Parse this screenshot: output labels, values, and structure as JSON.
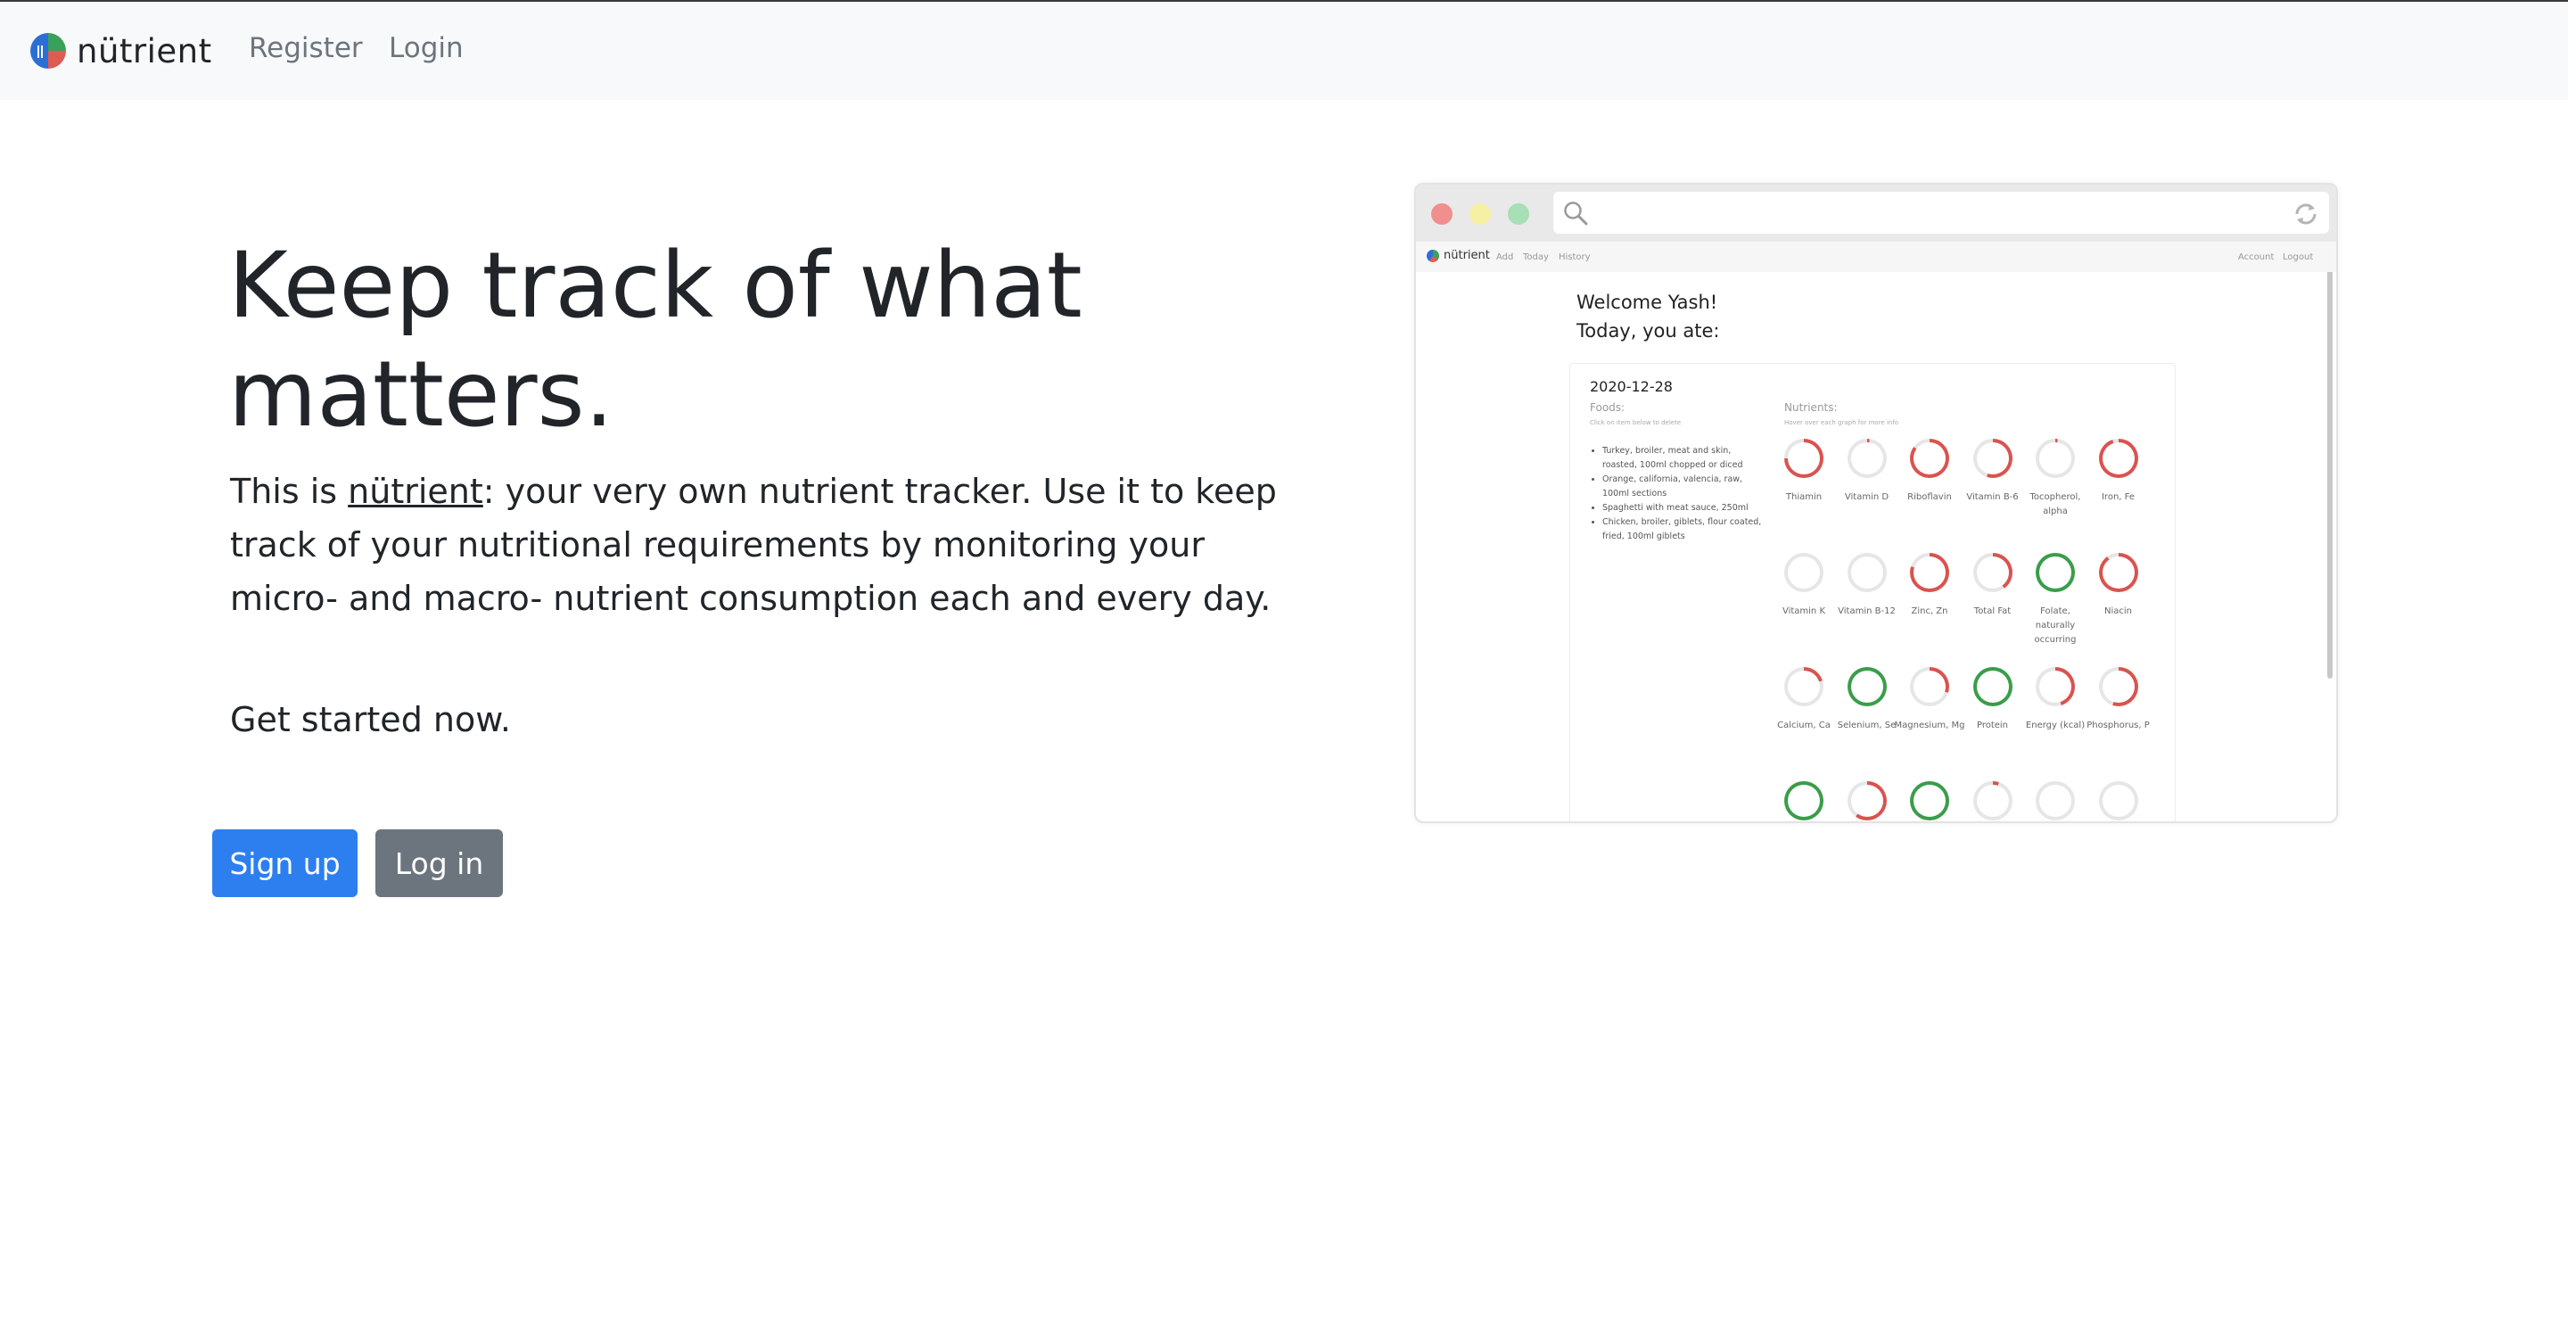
{
  "navbar": {
    "brand": "nütrient",
    "links": {
      "register": "Register",
      "login": "Login"
    }
  },
  "hero": {
    "title": "Keep track of what matters.",
    "text_prefix": "This is ",
    "text_brand": "nütrient",
    "text_suffix": ": your very own nutrient tracker. Use it to keep track of your nutritional requirements by monitoring your micro- and macro- nutrient consumption each and every day.",
    "cta": "Get started now.",
    "signup_label": "Sign up",
    "login_label": "Log in"
  },
  "colors": {
    "primary": "#2d7ff0",
    "secondary": "#6c757d",
    "ring_red": "#d9534f",
    "ring_green": "#3a9d4a",
    "ring_grey": "#e6e6e6"
  },
  "preview": {
    "nav": {
      "brand": "nütrient",
      "links": [
        "Add",
        "Today",
        "History"
      ],
      "right_links": [
        "Account",
        "Logout"
      ]
    },
    "welcome": "Welcome Yash!",
    "subtitle": "Today, you ate:",
    "date": "2020-12-28",
    "foods_label": "Foods:",
    "foods_hint": "Click on item below to delete",
    "foods": [
      "Turkey, broiler, meat and skin, roasted, 100ml chopped or diced",
      "Orange, california, valencia, raw, 100ml sections",
      "Spaghetti with meat sauce, 250ml",
      "Chicken, broiler, giblets, flour coated, fried, 100ml giblets"
    ],
    "nutrients_label": "Nutrients:",
    "nutrients_hint": "Hover over each graph for more info",
    "nutrients": [
      {
        "name": "Thiamin",
        "fraction": 0.75,
        "color": "red"
      },
      {
        "name": "Vitamin D",
        "fraction": 0.02,
        "color": "red"
      },
      {
        "name": "Riboflavin",
        "fraction": 0.85,
        "color": "red"
      },
      {
        "name": "Vitamin B-6",
        "fraction": 0.55,
        "color": "red"
      },
      {
        "name": "Tocopherol, alpha",
        "fraction": 0.02,
        "color": "red"
      },
      {
        "name": "Iron, Fe",
        "fraction": 0.95,
        "color": "red"
      },
      {
        "name": "Vitamin K",
        "fraction": 0.0,
        "color": "grey"
      },
      {
        "name": "Vitamin B-12",
        "fraction": 0.0,
        "color": "grey"
      },
      {
        "name": "Zinc, Zn",
        "fraction": 0.8,
        "color": "red"
      },
      {
        "name": "Total Fat",
        "fraction": 0.4,
        "color": "red"
      },
      {
        "name": "Folate, naturally occurring",
        "fraction": 1.0,
        "color": "green"
      },
      {
        "name": "Niacin",
        "fraction": 0.9,
        "color": "red"
      },
      {
        "name": "Calcium, Ca",
        "fraction": 0.2,
        "color": "red"
      },
      {
        "name": "Selenium, Se",
        "fraction": 1.0,
        "color": "green"
      },
      {
        "name": "Magnesium, Mg",
        "fraction": 0.3,
        "color": "red"
      },
      {
        "name": "Protein",
        "fraction": 1.0,
        "color": "green"
      },
      {
        "name": "Energy (kcal)",
        "fraction": 0.45,
        "color": "red"
      },
      {
        "name": "Phosphorus, P",
        "fraction": 0.55,
        "color": "red"
      },
      {
        "name": "",
        "fraction": 1.0,
        "color": "green"
      },
      {
        "name": "",
        "fraction": 0.6,
        "color": "red"
      },
      {
        "name": "",
        "fraction": 1.0,
        "color": "green"
      },
      {
        "name": "",
        "fraction": 0.05,
        "color": "red"
      },
      {
        "name": "",
        "fraction": 0.0,
        "color": "grey"
      },
      {
        "name": "",
        "fraction": 0.0,
        "color": "grey"
      }
    ]
  }
}
